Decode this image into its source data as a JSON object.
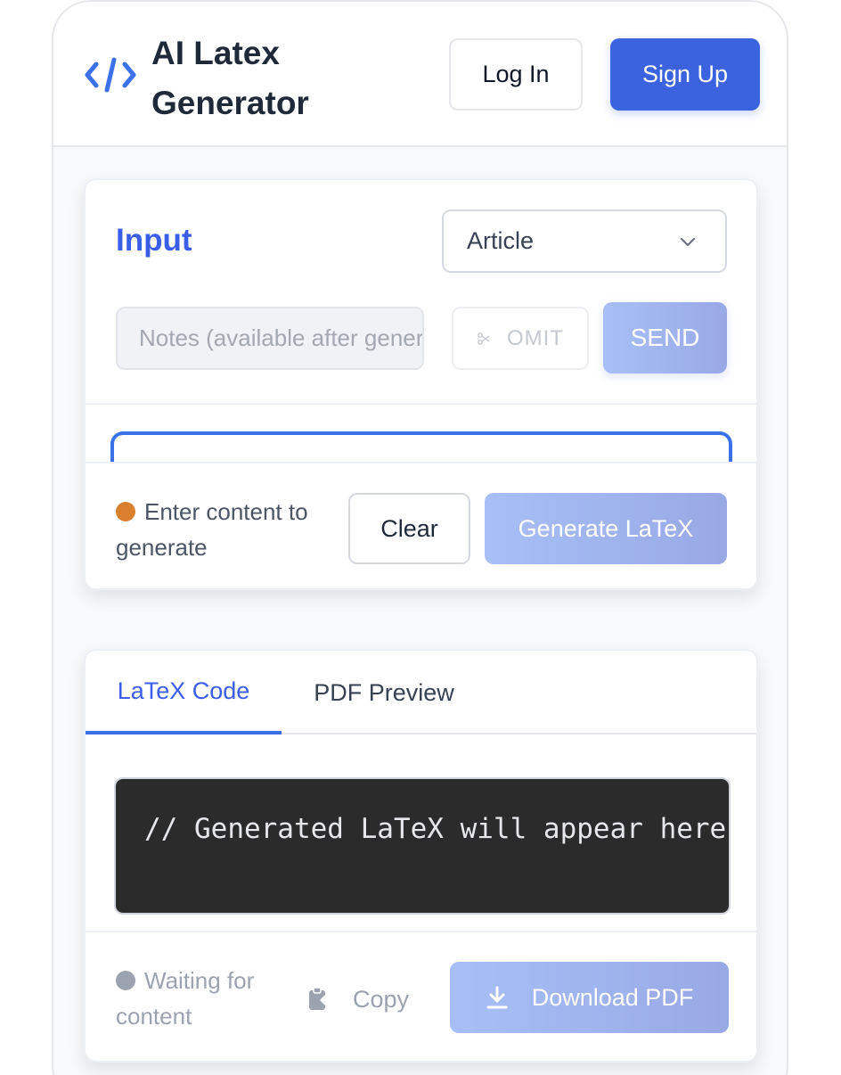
{
  "header": {
    "app_title": "AI Latex Generator",
    "logo_icon": "code-brackets-icon",
    "login_label": "Log In",
    "signup_label": "Sign Up"
  },
  "input_panel": {
    "title": "Input",
    "document_type": {
      "selected": "Article",
      "icon": "chevron-down-icon"
    },
    "notes_placeholder": "Notes (available after generation)",
    "omit_label": "OMIT",
    "omit_icon": "scissors-icon",
    "send_label": "SEND",
    "status_text": "Enter content to generate",
    "status_color": "#d97f2e",
    "clear_label": "Clear",
    "generate_label": "Generate LaTeX"
  },
  "output_panel": {
    "tabs": [
      {
        "label": "LaTeX Code",
        "active": true
      },
      {
        "label": "PDF Preview",
        "active": false
      }
    ],
    "code_placeholder": "// Generated LaTeX will appear here",
    "status_text": "Waiting for content",
    "status_color": "#9ca3af",
    "copy_label": "Copy",
    "copy_icon": "clipboard-icon",
    "download_label": "Download PDF",
    "download_icon": "download-icon"
  },
  "colors": {
    "accent": "#3b5ee8",
    "primary_button": "#3b63e0",
    "disabled_gradient_start": "#a7bff6",
    "disabled_gradient_end": "#98a9e6",
    "code_background": "#2b2b2b"
  }
}
